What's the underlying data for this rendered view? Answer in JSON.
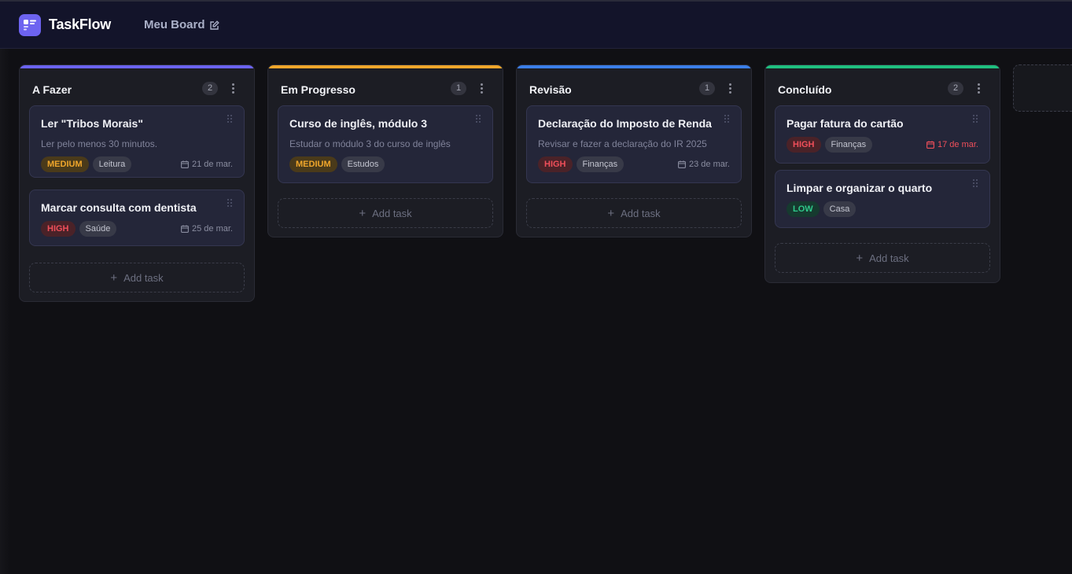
{
  "app": {
    "title": "TaskFlow",
    "board_name": "Meu Board",
    "logo_icon": "kanban-icon",
    "edit_icon": "edit-icon"
  },
  "labels": {
    "add_task": "Add task",
    "add_icon": "plus-icon"
  },
  "columns": [
    {
      "title": "A Fazer",
      "count": "2",
      "accent": "#6b63f0",
      "cards": [
        {
          "title": "Ler \"Tribos Morais\"",
          "desc": "Ler pelo menos 30 minutos.",
          "priority": "MEDIUM",
          "tag": "Leitura",
          "due": "21 de mar."
        },
        {
          "title": "Marcar consulta com dentista",
          "desc": "",
          "priority": "HIGH",
          "tag": "Saúde",
          "due": "25 de mar."
        }
      ]
    },
    {
      "title": "Em Progresso",
      "count": "1",
      "accent": "#f0a62b",
      "cards": [
        {
          "title": "Curso de inglês, módulo 3",
          "desc": "Estudar o módulo 3 do curso de inglês",
          "priority": "MEDIUM",
          "tag": "Estudos",
          "due": ""
        }
      ]
    },
    {
      "title": "Revisão",
      "count": "1",
      "accent": "#3b7ee8",
      "cards": [
        {
          "title": "Declaração do Imposto de Renda",
          "desc": "Revisar e fazer a declaração do IR 2025",
          "priority": "HIGH",
          "tag": "Finanças",
          "due": "23 de mar."
        }
      ]
    },
    {
      "title": "Concluído",
      "count": "2",
      "accent": "#1fbf7f",
      "cards": [
        {
          "title": "Pagar fatura do cartão",
          "desc": "",
          "priority": "HIGH",
          "tag": "Finanças",
          "due": "17 de mar."
        },
        {
          "title": "Limpar e organizar o quarto",
          "desc": "",
          "priority": "LOW",
          "tag": "Casa",
          "due": ""
        }
      ]
    }
  ],
  "colors": {
    "overdue": "#ef4f5a",
    "high": "#ef4f5a",
    "medium": "#f0a62b",
    "low": "#2fc98b"
  }
}
